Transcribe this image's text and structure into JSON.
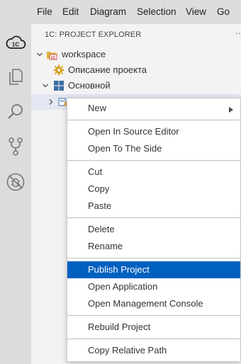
{
  "menubar": {
    "items": [
      "File",
      "Edit",
      "Diagram",
      "Selection",
      "View",
      "Go"
    ]
  },
  "activity": {
    "icons": [
      "cloud-1c-icon",
      "files-icon",
      "search-icon",
      "source-control-icon",
      "debug-icon"
    ]
  },
  "explorer": {
    "title": "1C: PROJECT EXPLORER",
    "tree": [
      {
        "label": "workspace",
        "icon": "workspace-1c-icon",
        "expanded": true
      },
      {
        "label": "Описание проекта",
        "icon": "gear-icon"
      },
      {
        "label": "Основной",
        "icon": "module-grid-icon",
        "expanded": true
      },
      {
        "label": "",
        "icon": "project-icon",
        "expanded": false,
        "selected": true
      }
    ]
  },
  "context_menu": {
    "groups": [
      [
        {
          "label": "New",
          "submenu": true
        }
      ],
      [
        {
          "label": "Open In Source Editor"
        },
        {
          "label": "Open To The Side"
        }
      ],
      [
        {
          "label": "Cut"
        },
        {
          "label": "Copy"
        },
        {
          "label": "Paste"
        }
      ],
      [
        {
          "label": "Delete"
        },
        {
          "label": "Rename"
        }
      ],
      [
        {
          "label": "Publish Project",
          "highlighted": true
        },
        {
          "label": "Open Application"
        },
        {
          "label": "Open Management Console"
        }
      ],
      [
        {
          "label": "Rebuild Project"
        }
      ],
      [
        {
          "label": "Copy Relative Path"
        }
      ]
    ]
  },
  "colors": {
    "highlight": "#0060c0",
    "gear": "#d4a017",
    "module": "#3a6ea5"
  }
}
